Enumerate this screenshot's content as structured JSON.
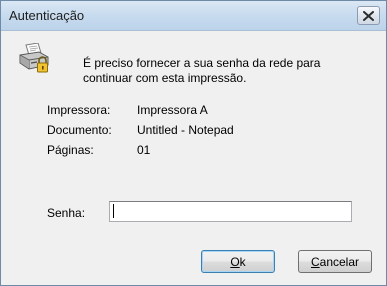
{
  "window": {
    "title": "Autenticação",
    "close_icon": "close-icon"
  },
  "message": "É preciso fornecer a sua senha da rede para continuar com esta impressão.",
  "icon": "printer-lock-icon",
  "info": [
    {
      "label": "Impressora:",
      "value": "Impressora A"
    },
    {
      "label": "Documento:",
      "value": "Untitled - Notepad"
    },
    {
      "label": "Páginas:",
      "value": "01"
    }
  ],
  "password": {
    "label": "Senha:",
    "value": "",
    "placeholder": ""
  },
  "buttons": {
    "ok": "Ok",
    "cancel": "Cancelar"
  },
  "colors": {
    "title_bar": "#c9dcef",
    "background": "#f0f0f0",
    "default_button_border": "#3c7fb1"
  }
}
